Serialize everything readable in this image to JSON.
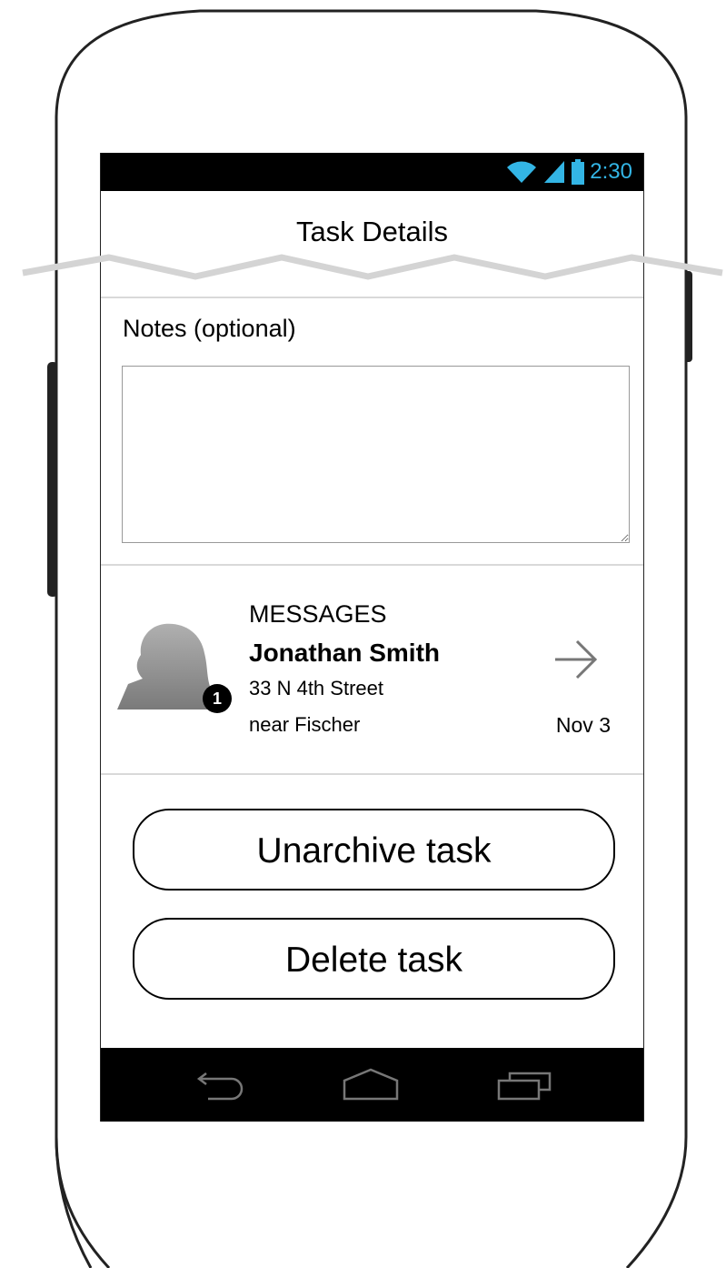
{
  "status_bar": {
    "time": "2:30",
    "icons": [
      "wifi-icon",
      "signal-icon",
      "battery-icon"
    ],
    "accent_color": "#33b5e5"
  },
  "header": {
    "title": "Task Details"
  },
  "notes": {
    "label": "Notes (optional)",
    "value": ""
  },
  "notification": {
    "category": "MESSAGES",
    "name": "Jonathan Smith",
    "address_line1": "33 N 4th Street",
    "address_line2": "near Fischer",
    "date": "Nov 3",
    "badge_count": "1",
    "icons": [
      "avatar-icon",
      "arrow-right-icon"
    ]
  },
  "actions": {
    "unarchive_label": "Unarchive task",
    "delete_label": "Delete task"
  },
  "nav_bar": {
    "icons": [
      "back-icon",
      "home-icon",
      "recent-apps-icon"
    ]
  }
}
